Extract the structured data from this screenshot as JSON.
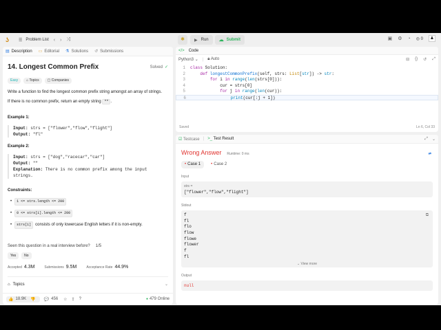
{
  "topbar": {
    "problem_list": "Problem List",
    "run": "Run",
    "submit": "Submit",
    "coins": "0"
  },
  "left_tabs": [
    {
      "label": "Description",
      "icon": "document-icon"
    },
    {
      "label": "Editorial",
      "icon": "book-icon"
    },
    {
      "label": "Solutions",
      "icon": "flask-icon"
    },
    {
      "label": "Submissions",
      "icon": "history-icon"
    }
  ],
  "problem": {
    "title": "14. Longest Common Prefix",
    "status": "Solved",
    "tags": {
      "difficulty": "Easy",
      "topics": "Topics",
      "companies": "Companies"
    },
    "desc1": "Write a function to find the longest common prefix string amongst an array of strings.",
    "desc2_before": "If there is no common prefix, return an empty string ",
    "desc2_code": "\"\"",
    "desc2_after": ".",
    "ex1_title": "Example 1:",
    "ex1_input_label": "Input:",
    "ex1_input": " strs = [\"flower\",\"flow\",\"flight\"]",
    "ex1_output_label": "Output:",
    "ex1_output": " \"fl\"",
    "ex2_title": "Example 2:",
    "ex2_input_label": "Input:",
    "ex2_input": " strs = [\"dog\",\"racecar\",\"car\"]",
    "ex2_output_label": "Output:",
    "ex2_output": " \"\"",
    "ex2_expl_label": "Explanation:",
    "ex2_expl": " There is no common prefix among the input strings.",
    "constraints_title": "Constraints:",
    "constraints": [
      {
        "code": "1 <= strs.length <= 200",
        "text": ""
      },
      {
        "code": "0 <= strs[i].length <= 200",
        "text": ""
      },
      {
        "code": "strs[i]",
        "text": "consists of only lowercase English letters if it is non-empty."
      }
    ],
    "seen_question": "Seen this question in a real interview before?",
    "seen_count": "1/5",
    "yes": "Yes",
    "no": "No",
    "accepted_label": "Accepted",
    "accepted": "4.3M",
    "submissions_label": "Submissions",
    "submissions": "9.5M",
    "acceptance_label": "Acceptance Rate",
    "acceptance": "44.9%",
    "topics": "Topics"
  },
  "footer": {
    "likes": "18.9K",
    "comments": "456",
    "online": "479 Online"
  },
  "editor": {
    "title": "Code",
    "language": "Python3",
    "mode": "Auto",
    "lines": [
      {
        "n": "1",
        "html_parts": [
          [
            "kw",
            "class"
          ],
          [
            "tx",
            " Solution:"
          ]
        ]
      },
      {
        "n": "2",
        "html_parts": [
          [
            "tx",
            "    "
          ],
          [
            "kw",
            "def"
          ],
          [
            "tx",
            " "
          ],
          [
            "fn",
            "longestCommonPrefix"
          ],
          [
            "tx",
            "(self, strs: "
          ],
          [
            "ty",
            "List"
          ],
          [
            "tx",
            "["
          ],
          [
            "bi",
            "str"
          ],
          [
            "tx",
            "]) -> "
          ],
          [
            "bi",
            "str"
          ],
          [
            "tx",
            ":"
          ]
        ]
      },
      {
        "n": "3",
        "html_parts": [
          [
            "tx",
            "        "
          ],
          [
            "kw",
            "for"
          ],
          [
            "tx",
            " i "
          ],
          [
            "kw",
            "in"
          ],
          [
            "tx",
            " "
          ],
          [
            "bi",
            "range"
          ],
          [
            "tx",
            "("
          ],
          [
            "bi",
            "len"
          ],
          [
            "tx",
            "(strs[0])):"
          ]
        ]
      },
      {
        "n": "4",
        "html_parts": [
          [
            "tx",
            "            cur = strs[0]"
          ]
        ]
      },
      {
        "n": "5",
        "html_parts": [
          [
            "tx",
            "            "
          ],
          [
            "kw",
            "for"
          ],
          [
            "tx",
            " j "
          ],
          [
            "kw",
            "in"
          ],
          [
            "tx",
            " "
          ],
          [
            "bi",
            "range"
          ],
          [
            "tx",
            "("
          ],
          [
            "bi",
            "len"
          ],
          [
            "tx",
            "(cur)):"
          ]
        ]
      },
      {
        "n": "6",
        "html_parts": [
          [
            "tx",
            "                "
          ],
          [
            "bi",
            "print"
          ],
          [
            "tx",
            "(cur[:j + 1])"
          ]
        ]
      }
    ],
    "saved": "Saved",
    "position": "Ln 6, Col 33"
  },
  "result": {
    "testcase_tab": "Testcase",
    "result_tab": "Test Result",
    "verdict": "Wrong Answer",
    "runtime": "Runtime: 0 ms",
    "cases": [
      "Case 1",
      "Case 2"
    ],
    "input_label": "Input",
    "input_var": "strs =",
    "input_value": "[\"flower\",\"flow\",\"flight\"]",
    "stdout_label": "Stdout",
    "stdout_lines": [
      "f",
      "fl",
      "flo",
      "flow",
      "flowe",
      "flower",
      "f",
      "fl"
    ],
    "view_more": "View more",
    "output_label": "Output",
    "output_value": "null"
  }
}
